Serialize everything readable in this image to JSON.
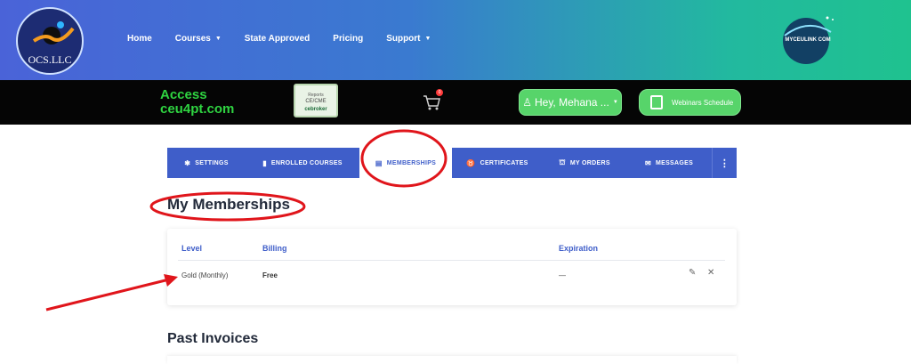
{
  "header": {
    "logo_text": "OCS.LLC",
    "nav": [
      {
        "label": "Home",
        "has_dropdown": false
      },
      {
        "label": "Courses",
        "has_dropdown": true
      },
      {
        "label": "State Approved",
        "has_dropdown": false
      },
      {
        "label": "Pricing",
        "has_dropdown": false
      },
      {
        "label": "Support",
        "has_dropdown": true
      }
    ],
    "partner_logo_text": "MYCEULINK COM",
    "dropdown_icon": "chevron-down-icon"
  },
  "topbar": {
    "access_line1": "Access",
    "access_line2": "ceu4pt.com",
    "badge_line1": "Reports",
    "badge_line2": "CE/CME",
    "badge_line3": "cebroker",
    "cart_count": "0",
    "user_button": "Hey, Mehana ...",
    "webinars_button": "Webinars Schedule"
  },
  "tabs": [
    {
      "label": "SETTINGS",
      "icon": "gear-icon",
      "active": false
    },
    {
      "label": "ENROLLED COURSES",
      "icon": "book-icon",
      "active": false
    },
    {
      "label": "MEMBERSHIPS",
      "icon": "id-card-icon",
      "active": true
    },
    {
      "label": "CERTIFICATES",
      "icon": "award-icon",
      "active": false
    },
    {
      "label": "MY ORDERS",
      "icon": "basket-icon",
      "active": false
    },
    {
      "label": "MESSAGES",
      "icon": "envelope-icon",
      "active": false
    }
  ],
  "memberships": {
    "title": "My Memberships",
    "headers": {
      "level": "Level",
      "billing": "Billing",
      "expiration": "Expiration"
    },
    "rows": [
      {
        "level": "Gold (Monthly)",
        "billing": "Free",
        "expiration": "—"
      }
    ]
  },
  "invoices": {
    "title": "Past Invoices"
  },
  "colors": {
    "primary": "#3f5ec9",
    "accent_green": "#57d46a",
    "annotation_red": "#e0151b"
  }
}
